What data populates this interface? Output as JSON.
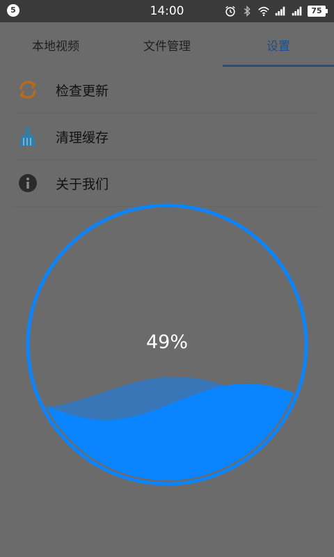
{
  "status_bar": {
    "notification_count": "5",
    "time": "14:00",
    "battery_level": "75",
    "icons": [
      "alarm-icon",
      "bluetooth-icon",
      "wifi-icon",
      "signal-icon",
      "signal-icon",
      "battery-icon"
    ]
  },
  "tabs": [
    {
      "label": "本地视频",
      "active": false
    },
    {
      "label": "文件管理",
      "active": false
    },
    {
      "label": "设置",
      "active": true
    }
  ],
  "settings": {
    "items": [
      {
        "label": "检查更新",
        "icon": "refresh-icon",
        "color": "#b86b1a"
      },
      {
        "label": "清理缓存",
        "icon": "broom-icon",
        "color": "#2f7fae"
      },
      {
        "label": "关于我们",
        "icon": "info-icon",
        "color": "#2b2b2b"
      }
    ]
  },
  "progress": {
    "value": 0.49,
    "label": "49%",
    "color": "#0a84ff"
  },
  "colors": {
    "background": "#6b6b6b",
    "status_bar": "#3a3a3a",
    "accent": "#1f4e8a"
  }
}
